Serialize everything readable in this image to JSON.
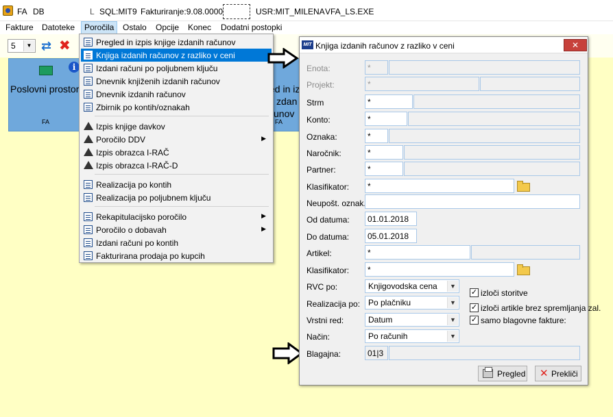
{
  "titlebar": {
    "fa": "FA",
    "db": "DB",
    "sep": "L",
    "sql": "SQL:MIT9",
    "fakturiranje": "Fakturiranje:9.08.0000",
    "usr": "USR:MIT_MILENA",
    "exe": "VFA_LS.EXE"
  },
  "menubar": [
    "Fakture",
    "Datoteke",
    "Poročila",
    "Ostalo",
    "Opcije",
    "Konec",
    "Dodatni postopki"
  ],
  "toolbar": {
    "combo_value": "5"
  },
  "tiles": [
    {
      "title": "Poslovni prostor",
      "foot": "FA"
    },
    {
      "title_line1": "ed in iz",
      "title_line2": "zdan",
      "title_line3": "unov",
      "foot": "FA"
    }
  ],
  "dropdown": {
    "items": [
      {
        "label": "Pregled in izpis knjige izdanih računov",
        "icon": "list-icon"
      },
      {
        "label": "Knjiga izdanih računov z razliko v ceni",
        "icon": "list-icon",
        "selected": true
      },
      {
        "label": "Izdani računi po poljubnem ključu",
        "icon": "list-icon"
      },
      {
        "label": "Dnevnik knjiženih izdanih računov",
        "icon": "list-icon"
      },
      {
        "label": "Dnevnik izdanih računov",
        "icon": "list-icon"
      },
      {
        "label": "Zbirnik po kontih/oznakah",
        "icon": "list-icon"
      },
      {
        "label": "Izpis knjige davkov",
        "icon": "durs-icon"
      },
      {
        "label": "Poročilo DDV",
        "icon": "durs-icon",
        "submenu": true
      },
      {
        "label": "Izpis obrazca I-RAČ",
        "icon": "durs-icon"
      },
      {
        "label": "Izpis obrazca I-RAČ-D",
        "icon": "durs-icon"
      },
      {
        "label": "Realizacija po kontih",
        "icon": "list-icon"
      },
      {
        "label": "Realizacija po poljubnem ključu",
        "icon": "list-icon"
      },
      {
        "label": "Rekapitulacijsko poročilo",
        "icon": "list-icon",
        "submenu": true
      },
      {
        "label": "Poročilo o dobavah",
        "icon": "list-icon",
        "submenu": true
      },
      {
        "label": "Izdani računi po kontih",
        "icon": "list-icon"
      },
      {
        "label": "Fakturirana prodaja po kupcih",
        "icon": "list-icon"
      }
    ]
  },
  "dialog": {
    "logo": "MIT",
    "title": "Knjiga izdanih računov z razliko v ceni",
    "close": "✕",
    "fields": {
      "enota": {
        "label": "Enota:",
        "value": "*"
      },
      "projekt": {
        "label": "Projekt:",
        "value": "*"
      },
      "strm": {
        "label": "Strm",
        "value": "*"
      },
      "konto": {
        "label": "Konto:",
        "value": "*"
      },
      "oznaka": {
        "label": "Oznaka:",
        "value": "*"
      },
      "narocnik": {
        "label": "Naročnik:",
        "value": "*"
      },
      "partner": {
        "label": "Partner:",
        "value": "*"
      },
      "klasifikator1": {
        "label": "Klasifikator:",
        "value": "*"
      },
      "neupost": {
        "label": "Neupošt. oznak.:",
        "value": ""
      },
      "od_datuma": {
        "label": "Od datuma:",
        "value": "01.01.2018"
      },
      "do_datuma": {
        "label": "Do datuma:",
        "value": "05.01.2018"
      },
      "artikel": {
        "label": "Artikel:",
        "value": "*"
      },
      "klasifikator2": {
        "label": "Klasifikator:",
        "value": "*"
      },
      "rvc_po": {
        "label": "RVC po:",
        "value": "Knjigovodska cena"
      },
      "realizacija_po": {
        "label": "Realizacija po:",
        "value": "Po plačniku"
      },
      "vrstni_red": {
        "label": "Vrstni red:",
        "value": "Datum"
      },
      "nacin": {
        "label": "Način:",
        "value": "Po računih"
      },
      "blagajna": {
        "label": "Blagajna:",
        "value": "01|3"
      }
    },
    "checkboxes": [
      {
        "label": "izloči storitve",
        "checked": true
      },
      {
        "label": "izloči artikle brez spremljanja zal.",
        "checked": true
      },
      {
        "label": "samo blagovne fakture:",
        "checked": true
      }
    ],
    "buttons": {
      "print": "Pregled",
      "cancel": "Prekliči"
    }
  }
}
